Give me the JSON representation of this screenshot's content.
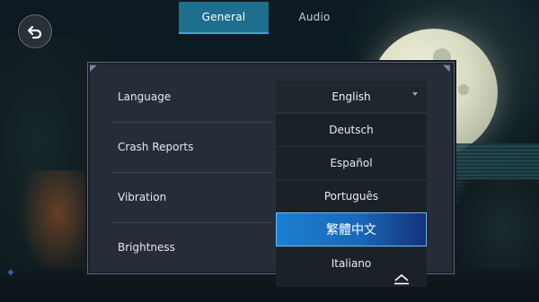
{
  "tabs": {
    "general": "General",
    "audio": "Audio"
  },
  "back_icon": "undo-arrow-icon",
  "settings": {
    "rows": [
      {
        "label": "Language"
      },
      {
        "label": "Crash Reports"
      },
      {
        "label": "Vibration"
      },
      {
        "label": "Brightness"
      }
    ]
  },
  "language_dropdown": {
    "selected": "English",
    "options": [
      "Deutsch",
      "Español",
      "Português",
      "繁體中文",
      "Italiano"
    ],
    "highlighted": "繁體中文"
  },
  "colors": {
    "active_tab": "#1e6e8e",
    "highlight_start": "#1c7fd0",
    "highlight_end": "#13327a",
    "panel_bg": "#262d39"
  }
}
